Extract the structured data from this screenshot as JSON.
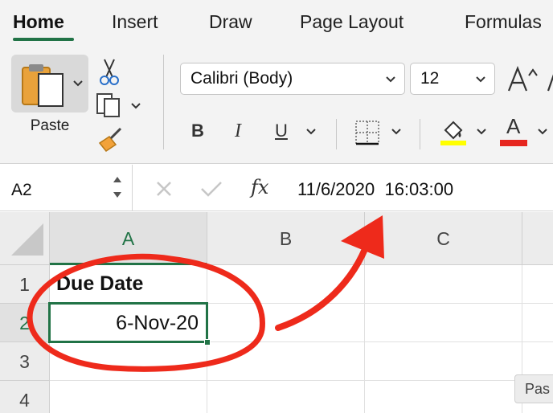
{
  "tabs": [
    {
      "label": "Home"
    },
    {
      "label": "Insert"
    },
    {
      "label": "Draw"
    },
    {
      "label": "Page Layout"
    },
    {
      "label": "Formulas"
    }
  ],
  "ribbon": {
    "paste_label": "Paste",
    "font_name": "Calibri (Body)",
    "font_size": "12",
    "bold": "B",
    "italic": "I",
    "underline": "U",
    "font_color_letter": "A",
    "highlight_color": "#ffff00",
    "font_color": "#e6261f"
  },
  "formula_bar": {
    "name_box": "A2",
    "fx": "fx",
    "formula": "11/6/2020  16:03:00"
  },
  "grid": {
    "columns": [
      "A",
      "B",
      "C"
    ],
    "rows": [
      "1",
      "2",
      "3",
      "4"
    ],
    "cells": {
      "a1": "Due Date",
      "a2": "6-Nov-20"
    },
    "selected_cell": "A2",
    "paste_tooltip": "Pas"
  },
  "colors": {
    "accent": "#217346",
    "annotation": "#ee2a1b"
  }
}
